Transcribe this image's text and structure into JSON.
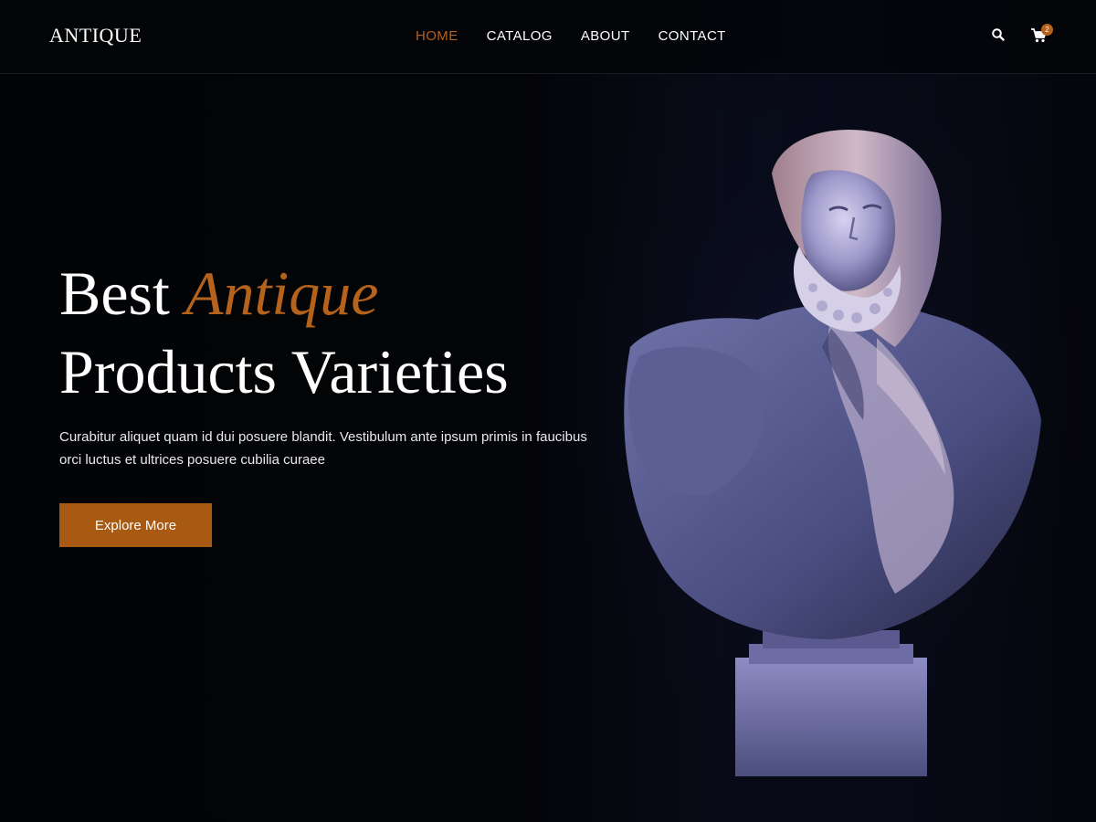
{
  "brand": {
    "logo_text": "ANTIQUE"
  },
  "nav": {
    "items": [
      {
        "label": "HOME",
        "active": true
      },
      {
        "label": "CATALOG",
        "active": false
      },
      {
        "label": "ABOUT",
        "active": false
      },
      {
        "label": "CONTACT",
        "active": false
      }
    ]
  },
  "header_icons": {
    "search": "search-icon",
    "cart": "cart-icon",
    "cart_count": "2"
  },
  "hero": {
    "title_part1": "Best",
    "title_accent": "Antique",
    "title_line2": "Products Varieties",
    "description": "Curabitur aliquet quam id dui posuere blandit. Vestibulum ante ipsum primis in faucibus orci luctus et ultrices posuere cubilia curaee",
    "cta_label": "Explore More"
  },
  "colors": {
    "accent": "#b5621c",
    "button": "#a85a13",
    "background": "#030407",
    "text": "#ffffff"
  }
}
